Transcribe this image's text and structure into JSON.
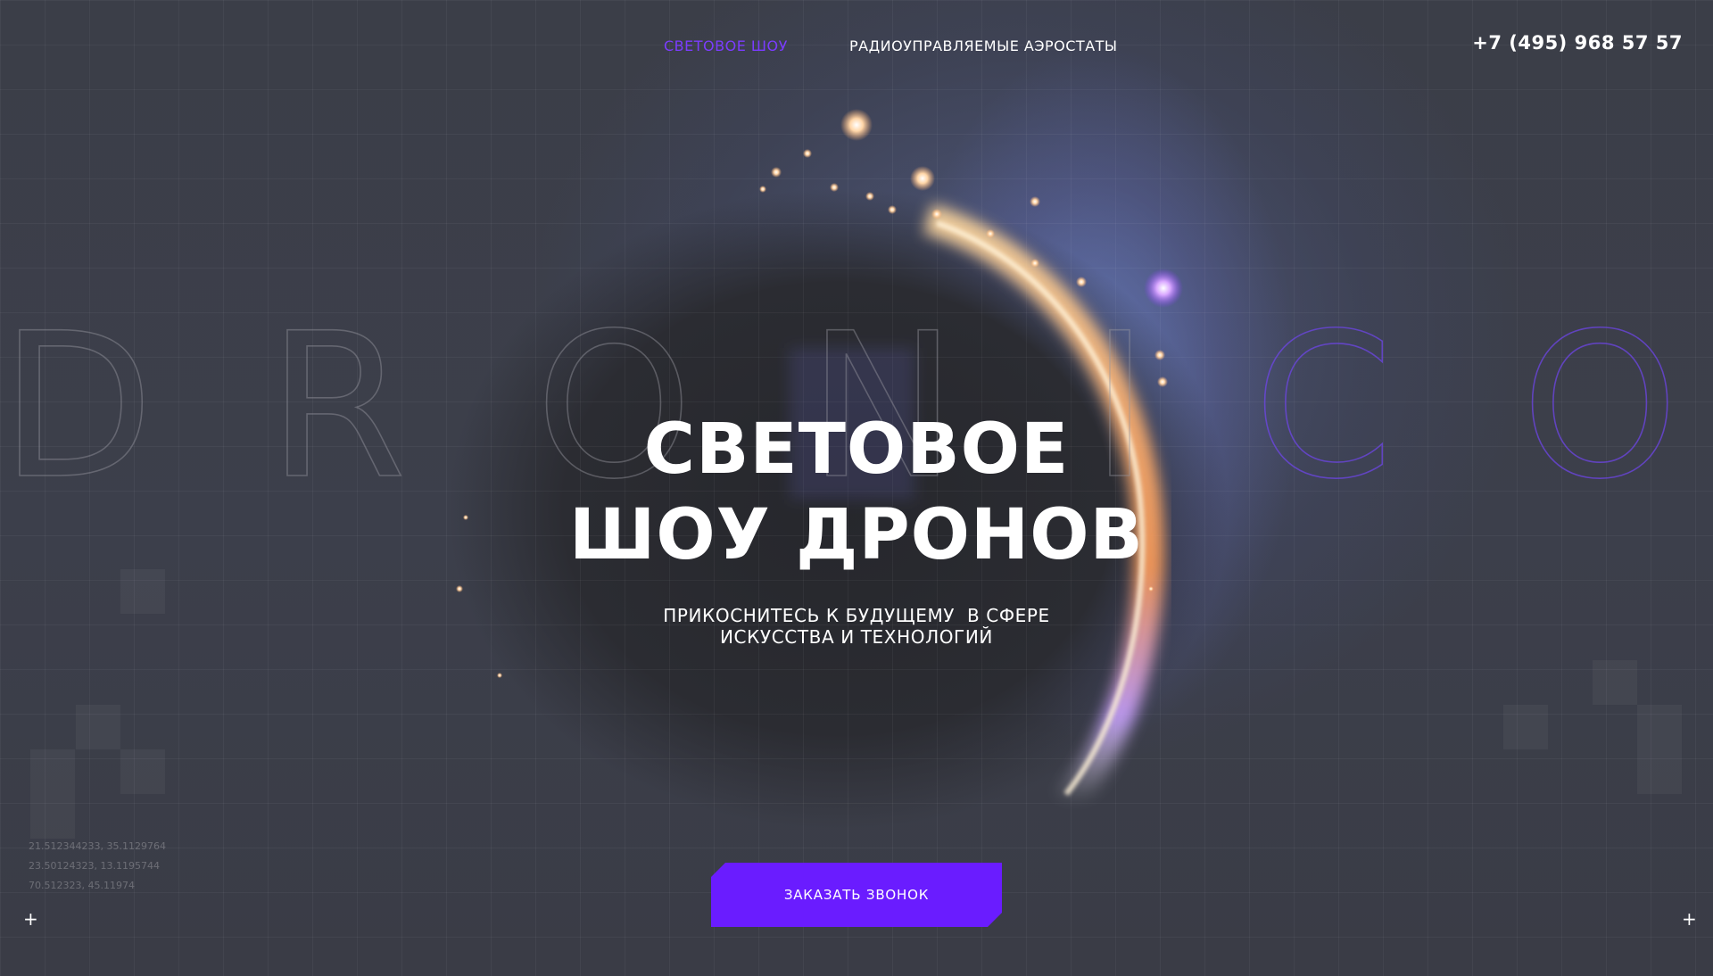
{
  "nav": {
    "items": [
      {
        "label": "СВЕТОВОЕ ШОУ",
        "active": true
      },
      {
        "label": "РАДИОУПРАВЛЯЕМЫЕ АЭРОСТАТЫ",
        "active": false
      }
    ],
    "phone": "+7 (495) 968 57 57"
  },
  "background_word": {
    "letters": [
      "D",
      "R",
      "O",
      "N",
      "I",
      "C",
      "O"
    ]
  },
  "hero": {
    "title_line1": "СВЕТОВОЕ",
    "title_line2": "ШОУ ДРОНОВ",
    "subtitle_line1": "ПРИКОСНИТЕСЬ К БУДУЩЕМУ  В СФЕРЕ",
    "subtitle_line2": "ИСКУССТВА И ТЕХНОЛОГИЙ"
  },
  "cta": {
    "label": "ЗАКАЗАТЬ ЗВОНОК"
  },
  "coordinates": [
    "21.512344233, 35.1129764",
    "23.50124323, 13.1195744",
    "70.512323, 45.11974"
  ],
  "corner_markers": [
    "+",
    "+"
  ],
  "colors": {
    "accent": "#6a1cff",
    "active_link": "#7b3cff",
    "background": "#3a3d48"
  }
}
